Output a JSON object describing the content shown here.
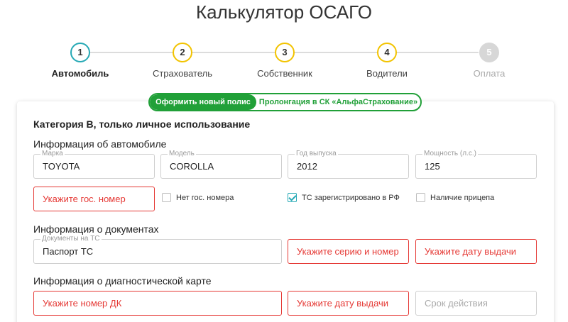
{
  "title": "Калькулятор ОСАГО",
  "steps": [
    {
      "num": "1",
      "label": "Автомобиль",
      "state": "active"
    },
    {
      "num": "2",
      "label": "Страхователь",
      "state": "pending"
    },
    {
      "num": "3",
      "label": "Собственник",
      "state": "pending"
    },
    {
      "num": "4",
      "label": "Водители",
      "state": "pending"
    },
    {
      "num": "5",
      "label": "Оплата",
      "state": "disabled"
    }
  ],
  "toggle": {
    "new_policy": "Оформить новый полис",
    "prolongation": "Пролонгация в СК «АльфаСтрахование»"
  },
  "category": "Категория B, только личное использование",
  "car_section": {
    "heading": "Информация об автомобиле",
    "make": {
      "label": "Марка",
      "value": "TOYOTA"
    },
    "model": {
      "label": "Модель",
      "value": "COROLLA"
    },
    "year": {
      "label": "Год выпуска",
      "value": "2012"
    },
    "power": {
      "label": "Мощность (л.с.)",
      "value": "125"
    },
    "plate_error": "Укажите гос. номер",
    "no_plate": {
      "label": "Нет гос. номера",
      "checked": false
    },
    "registered_rf": {
      "label": "ТС зарегистрировано в РФ",
      "checked": true
    },
    "trailer": {
      "label": "Наличие прицепа",
      "checked": false
    }
  },
  "docs_section": {
    "heading": "Информация о документах",
    "doc_type": {
      "label": "Документы на ТС",
      "value": "Паспорт ТС"
    },
    "series_error": "Укажите серию и номер",
    "date_error": "Укажите дату выдачи"
  },
  "diag_section": {
    "heading": "Информация о диагностической карте",
    "number_error": "Укажите номер ДК",
    "date_error": "Укажите дату выдачи",
    "validity_placeholder": "Срок действия"
  },
  "colors": {
    "accent_green": "#21a038",
    "active_step": "#26a9b5",
    "pending_step": "#f2c300",
    "error": "#e53935"
  }
}
